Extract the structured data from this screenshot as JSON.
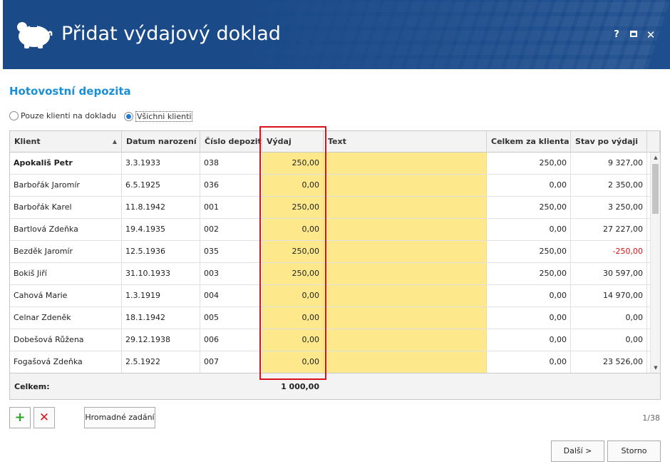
{
  "window": {
    "title": "Přidat výdajový doklad",
    "help_label": "?",
    "close_label": "✕"
  },
  "section": {
    "title": "Hotovostní depozita"
  },
  "filter": {
    "option1": "Pouze klienti na dokladu",
    "option2": "Všichni klienti",
    "selected": "Všichni klienti"
  },
  "table": {
    "columns": [
      "Klient",
      "Datum narození",
      "Číslo depozita",
      "Výdaj",
      "Text",
      "Celkem za klienta",
      "Stav po výdaji"
    ],
    "rows": [
      {
        "klient": "Apokališ Petr",
        "datum": "3.3.1933",
        "cislo": "038",
        "vydaj": "250,00",
        "text": "",
        "celkem": "250,00",
        "stav": "9 327,00"
      },
      {
        "klient": "Barbořák Jaromír",
        "datum": "6.5.1925",
        "cislo": "036",
        "vydaj": "0,00",
        "text": "",
        "celkem": "0,00",
        "stav": "2 350,00"
      },
      {
        "klient": "Barbořák Karel",
        "datum": "11.8.1942",
        "cislo": "001",
        "vydaj": "250,00",
        "text": "",
        "celkem": "250,00",
        "stav": "3 250,00"
      },
      {
        "klient": "Bartlová Zdeňka",
        "datum": "19.4.1935",
        "cislo": "002",
        "vydaj": "0,00",
        "text": "",
        "celkem": "0,00",
        "stav": "27 227,00"
      },
      {
        "klient": "Bezděk Jaromír",
        "datum": "12.5.1936",
        "cislo": "035",
        "vydaj": "250,00",
        "text": "",
        "celkem": "250,00",
        "stav": "-250,00"
      },
      {
        "klient": "Bokiš Jiří",
        "datum": "31.10.1933",
        "cislo": "003",
        "vydaj": "250,00",
        "text": "",
        "celkem": "250,00",
        "stav": "30 597,00"
      },
      {
        "klient": "Cahová Marie",
        "datum": "1.3.1919",
        "cislo": "004",
        "vydaj": "0,00",
        "text": "",
        "celkem": "0,00",
        "stav": "14 970,00"
      },
      {
        "klient": "Celnar Zdeněk",
        "datum": "18.1.1942",
        "cislo": "005",
        "vydaj": "0,00",
        "text": "",
        "celkem": "0,00",
        "stav": "0,00"
      },
      {
        "klient": "Dobešová Růžena",
        "datum": "29.12.1938",
        "cislo": "006",
        "vydaj": "0,00",
        "text": "",
        "celkem": "0,00",
        "stav": "0,00"
      },
      {
        "klient": "Fogašová Zdeňka",
        "datum": "2.5.1922",
        "cislo": "007",
        "vydaj": "0,00",
        "text": "",
        "celkem": "0,00",
        "stav": "23 526,00"
      }
    ],
    "footer_label": "Celkem:",
    "footer_total": "1 000,00"
  },
  "toolbar": {
    "add_label": "+",
    "delete_label": "✕",
    "bulk_label": "Hromadné zadání",
    "pager": "1/38"
  },
  "buttons": {
    "next": "Další >",
    "cancel": "Storno"
  },
  "colors": {
    "header": "#1f4f8f",
    "accent": "#1a8fd6",
    "editable": "#fde98c",
    "highlight": "#d8121b",
    "negative": "#e01010"
  }
}
